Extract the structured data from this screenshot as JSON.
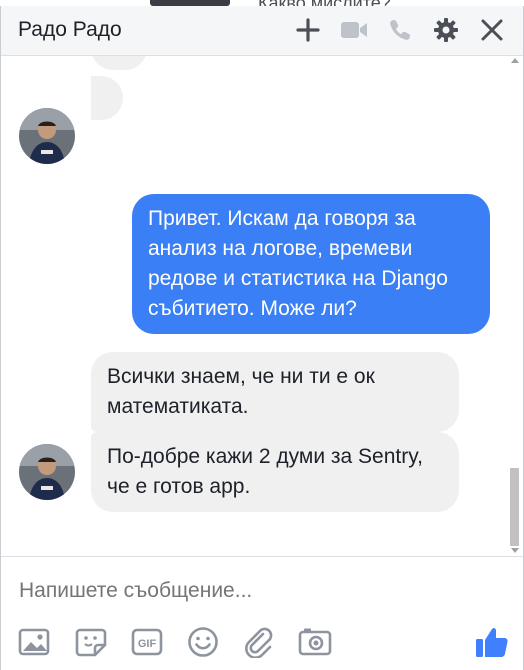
{
  "background": {
    "peek_text": "Какво мислите?"
  },
  "header": {
    "title": "Радо Радо",
    "icons": [
      "plus-icon",
      "video-call-icon",
      "phone-icon",
      "gear-icon",
      "close-icon"
    ]
  },
  "messages": [
    {
      "direction": "outgoing",
      "text": "Привет. Искам да говоря за анализ на логове, времеви редове и статистика на Django събитието. Може ли?"
    },
    {
      "direction": "incoming",
      "text": "Всички знаем, че ни ти е ок математиката."
    },
    {
      "direction": "incoming",
      "text": "По-добре кажи 2 думи за Sentry, че е готов арр."
    }
  ],
  "composer": {
    "placeholder": "Напишете съобщение...",
    "toolbar_icons": [
      "photo-icon",
      "sticker-icon",
      "gif-icon",
      "emoji-icon",
      "attachment-icon",
      "camera-icon",
      "thumbs-up-icon"
    ]
  },
  "colors": {
    "accent": "#3a7ff5",
    "incoming_bubble": "#f1f0f0",
    "header_bg": "#f5f6f7",
    "icon_gray": "#4b4f56",
    "like_blue": "#4080ff"
  }
}
